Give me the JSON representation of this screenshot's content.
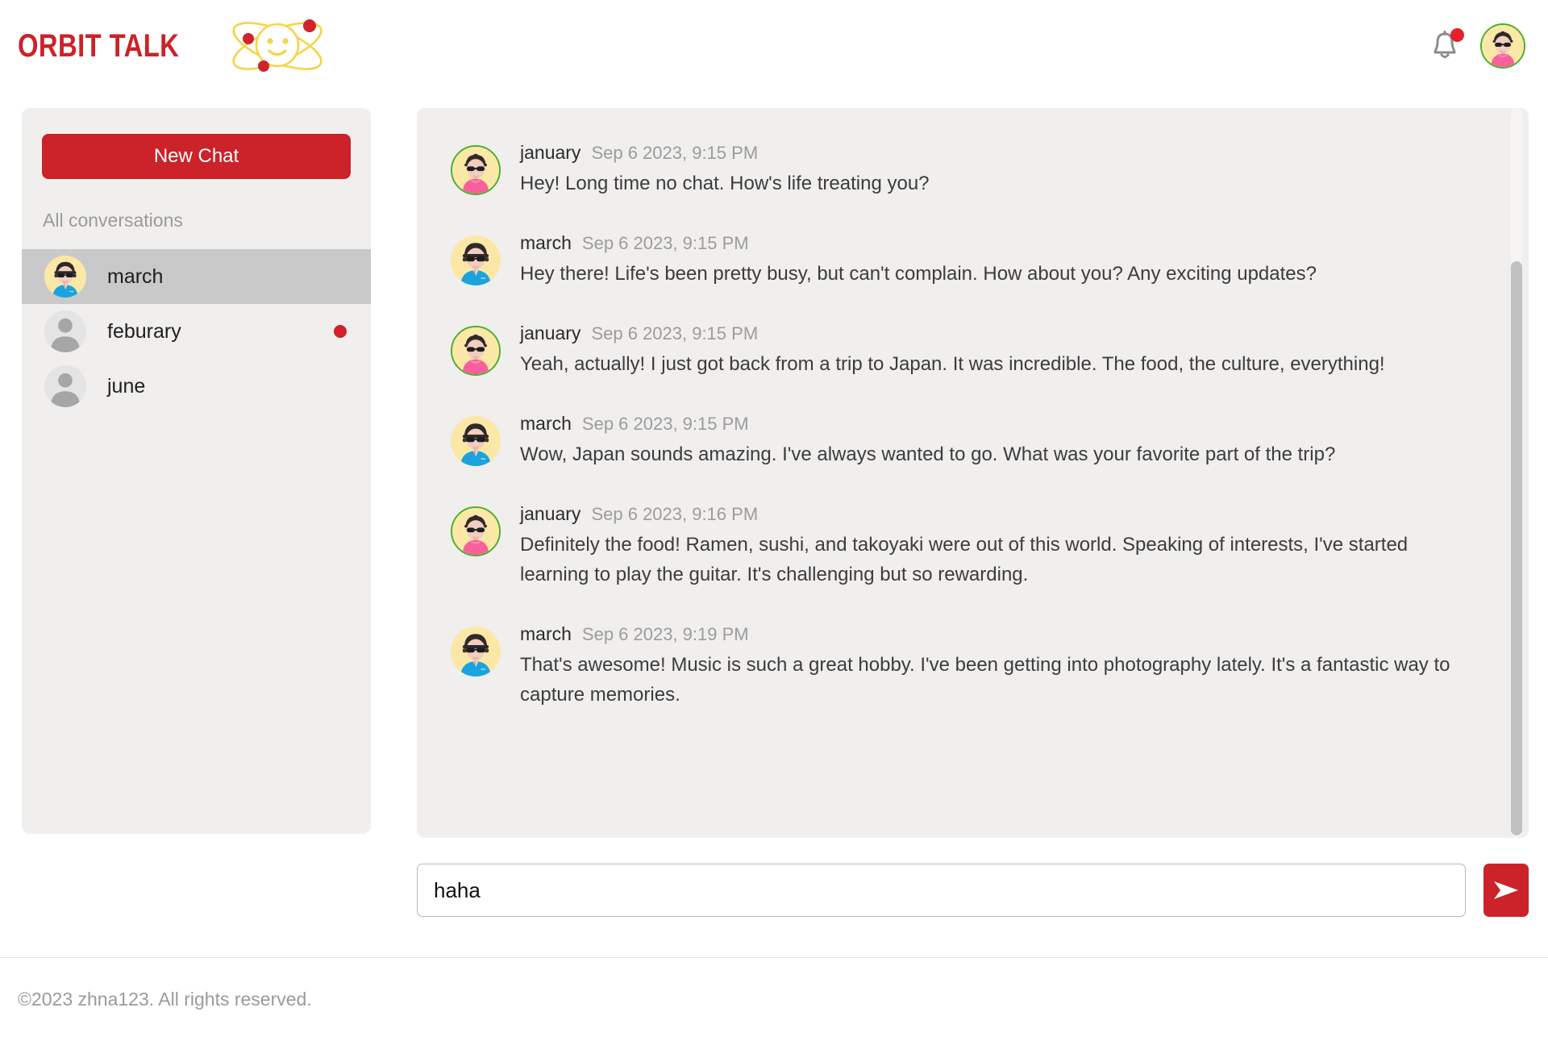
{
  "header": {
    "brand_name": "ORBIT TALK",
    "logo_icon": "atom-smiley-icon",
    "notification_icon": "bell-icon",
    "notification_badge": "",
    "avatar_icon": "user-avatar-january"
  },
  "sidebar": {
    "new_chat_label": "New Chat",
    "section_label": "All conversations",
    "conversations": [
      {
        "name": "march",
        "avatar": "avatar-march",
        "active": true,
        "unread": false
      },
      {
        "name": "feburary",
        "avatar": "avatar-generic",
        "active": false,
        "unread": true
      },
      {
        "name": "june",
        "avatar": "avatar-generic",
        "active": false,
        "unread": false
      }
    ]
  },
  "chat": {
    "messages": [
      {
        "author": "january",
        "time": "Sep 6 2023, 9:15 PM",
        "text": "Hey! Long time no chat. How's life treating you?",
        "avatar": "avatar-january"
      },
      {
        "author": "march",
        "time": "Sep 6 2023, 9:15 PM",
        "text": "Hey there! Life's been pretty busy, but can't complain. How about you? Any exciting updates?",
        "avatar": "avatar-march"
      },
      {
        "author": "january",
        "time": "Sep 6 2023, 9:15 PM",
        "text": "Yeah, actually! I just got back from a trip to Japan. It was incredible. The food, the culture, everything!",
        "avatar": "avatar-january"
      },
      {
        "author": "march",
        "time": "Sep 6 2023, 9:15 PM",
        "text": "Wow, Japan sounds amazing. I've always wanted to go. What was your favorite part of the trip?",
        "avatar": "avatar-march"
      },
      {
        "author": "january",
        "time": "Sep 6 2023, 9:16 PM",
        "text": "Definitely the food! Ramen, sushi, and takoyaki were out of this world. Speaking of interests, I've started learning to play the guitar. It's challenging but so rewarding.",
        "avatar": "avatar-january"
      },
      {
        "author": "march",
        "time": "Sep 6 2023, 9:19 PM",
        "text": "That's awesome! Music is such a great hobby. I've been getting into photography lately. It's a fantastic way to capture memories.",
        "avatar": "avatar-march"
      }
    ]
  },
  "composer": {
    "value": "haha",
    "placeholder": "",
    "send_icon": "send-paper-plane-icon"
  },
  "footer": {
    "copyright": "©2023 zhna123. All rights reserved."
  },
  "colors": {
    "brand_red": "#cc2229",
    "unread_red": "#d3202a",
    "panel_gray": "#f0efee",
    "active_gray": "#c9c9c9",
    "avatar_ring_green": "#4caf2f",
    "avatar_cream": "#fbe8a6"
  }
}
